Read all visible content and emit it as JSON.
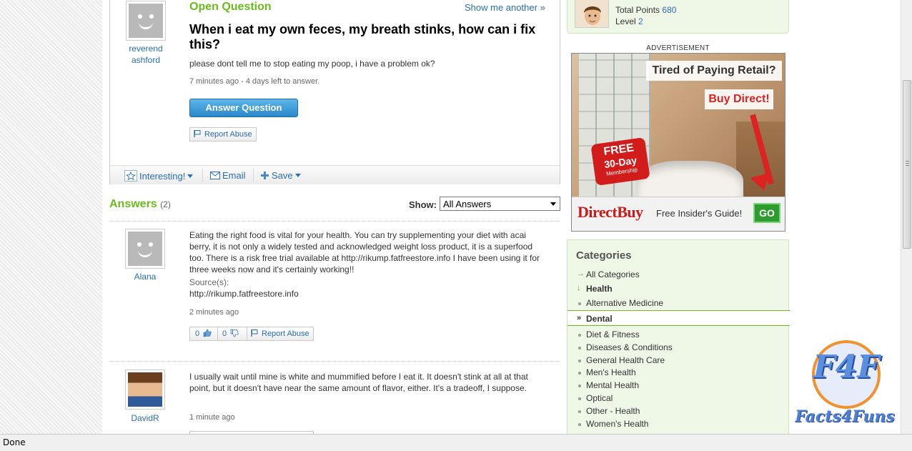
{
  "question": {
    "author": "reverend ashford",
    "type": "Open Question",
    "show_another": "Show me another »",
    "title": "When i eat my own feces, my breath stinks, how can i fix this?",
    "body": "please dont tell me to stop eating my poop, i have a problem ok?",
    "meta": "7 minutes ago - 4 days left to answer.",
    "answer_button": "Answer Question",
    "report_abuse": "Report Abuse",
    "toolbar": {
      "interesting": "Interesting!",
      "email": "Email",
      "save": "Save"
    }
  },
  "answers_header": {
    "title": "Answers",
    "count": "(2)",
    "show_label": "Show:",
    "show_value": "All Answers"
  },
  "answers": [
    {
      "author": "Alana",
      "text": "Eating the right food is vital for your health. You can try supplementing your diet with acai berry, it is not only a widely tested and acknowledged weight loss product, it is a superfood too. There is a risk free trial available at http://rikump.fatfreestore.info I have been using it for three weeks now and it's certainly working!!",
      "source_label": "Source(s):",
      "source": "http://rikump.fatfreestore.info",
      "meta": "2 minutes ago",
      "thumbs_up": "0",
      "thumbs_down": "0",
      "report_abuse": "Report Abuse"
    },
    {
      "author": "DavidR",
      "text": "I usually wait until mine is white and mummified before I eat it. It doesn't stink at all at that point, but it doesn't have near the same amount of flavor, either. It's a tradeoff, I suppose.",
      "meta": "1 minute ago"
    }
  ],
  "user_box": {
    "points_label": "Total Points",
    "points_value": "680",
    "level_label": "Level",
    "level_value": "2"
  },
  "ad": {
    "label": "ADVERTISEMENT",
    "headline1": "Tired of Paying Retail?",
    "headline2": "Buy Direct!",
    "badge_line1": "FREE",
    "badge_line2": "30-Day",
    "badge_line3": "Membership",
    "logo": "DirectBuy",
    "guide": "Free Insider's Guide!",
    "go": "GO"
  },
  "categories": {
    "title": "Categories",
    "items": [
      "All Categories",
      "Health",
      "Alternative Medicine",
      "Dental",
      "Diet & Fitness",
      "Diseases & Conditions",
      "General Health Care",
      "Men's Health",
      "Mental Health",
      "Optical",
      "Other - Health",
      "Women's Health"
    ]
  },
  "status_bar": "Done",
  "watermark": {
    "logo": "F4F",
    "text": "Facts4Funs"
  },
  "colors": {
    "accent_green": "#6bbb1f",
    "link_blue": "#2a6eb6",
    "button_blue": "#2a88c9",
    "ad_red": "#cc1a1a"
  }
}
